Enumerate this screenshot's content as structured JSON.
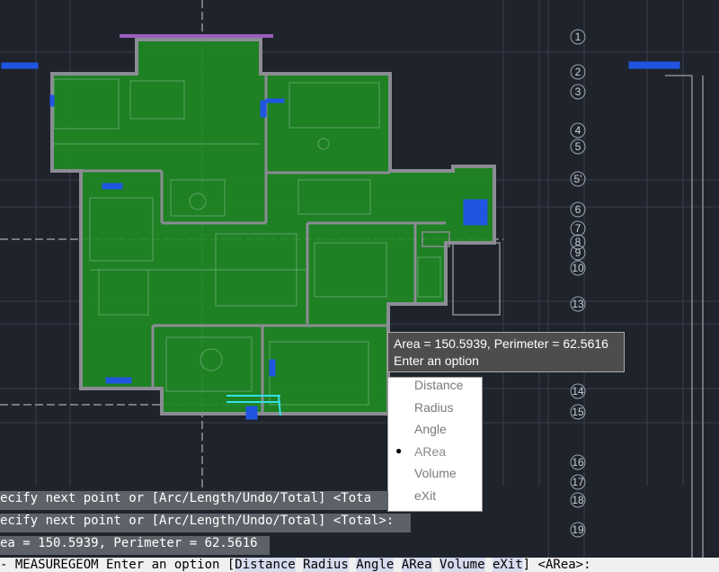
{
  "tooltip": {
    "line1": "Area = 150.5939, Perimeter = 62.5616",
    "line2": "Enter an option"
  },
  "menu": {
    "items": [
      "Distance",
      "Radius",
      "Angle",
      "ARea",
      "Volume",
      "eXit"
    ],
    "selected_index": 3
  },
  "command_history": [
    "ecify next point or [Arc/Length/Undo/Total] <Tota",
    "ecify next point or [Arc/Length/Undo/Total] <Total>:",
    "ea = 150.5939, Perimeter = 62.5616"
  ],
  "command_prompt": {
    "prefix": "- MEASUREGEOM Enter an option [",
    "options": [
      "Distance",
      "Radius",
      "Angle",
      "ARea",
      "Volume",
      "eXit"
    ],
    "suffix": "] <ARea>:"
  },
  "grid_bubbles": [
    "1",
    "2",
    "3",
    "4",
    "5",
    "5'",
    "6",
    "7",
    "8",
    "9",
    "10",
    "13",
    "14",
    "15",
    "16",
    "17",
    "18",
    "19"
  ],
  "colors": {
    "background": "#1f232c",
    "area_fill": "#1e8a24",
    "walls": "#8c8c95",
    "accent_blue": "#1f55e0"
  }
}
